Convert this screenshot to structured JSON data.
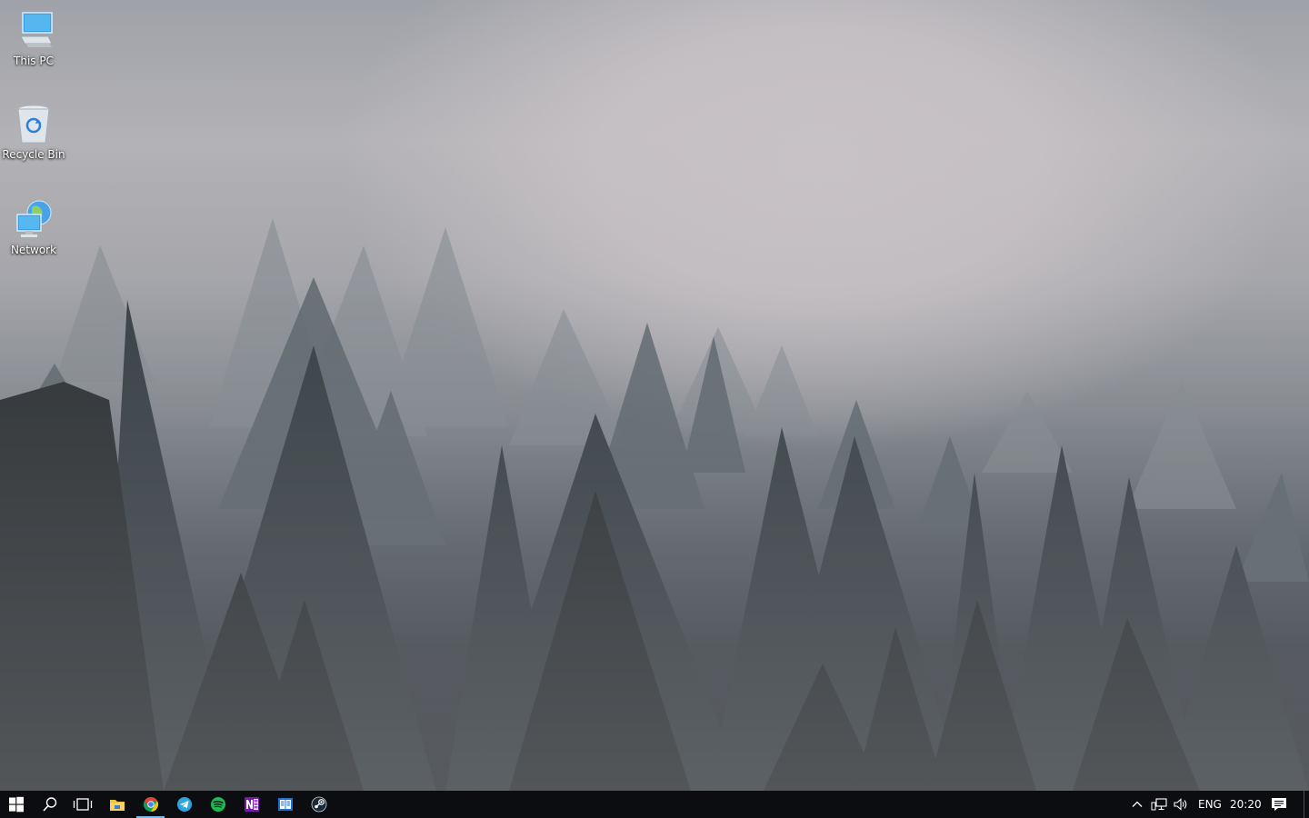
{
  "desktop": {
    "icons": [
      {
        "label": "This PC",
        "icon": "this-pc-icon"
      },
      {
        "label": "Recycle Bin",
        "icon": "recycle-bin-icon"
      },
      {
        "label": "Network",
        "icon": "network-icon"
      }
    ]
  },
  "taskbar": {
    "start": {
      "icon": "windows-start-icon"
    },
    "search": {
      "icon": "search-icon"
    },
    "task_view": {
      "icon": "task-view-icon"
    },
    "apps": [
      {
        "name": "File Explorer",
        "icon": "file-explorer-icon",
        "active": false
      },
      {
        "name": "Google Chrome",
        "icon": "chrome-icon",
        "active": true
      },
      {
        "name": "Telegram",
        "icon": "telegram-icon",
        "active": false
      },
      {
        "name": "Spotify",
        "icon": "spotify-icon",
        "active": false
      },
      {
        "name": "OneNote",
        "icon": "onenote-icon",
        "active": false
      },
      {
        "name": "Reader",
        "icon": "reader-icon",
        "active": false
      },
      {
        "name": "Steam",
        "icon": "steam-icon",
        "active": false
      }
    ],
    "tray": {
      "language": "ENG",
      "time": "20:20",
      "icons": [
        "show-hidden-icons-chevron-icon",
        "network-status-icon",
        "volume-icon",
        "action-center-icon"
      ]
    }
  },
  "colors": {
    "taskbar_bg": "#0c0d10",
    "active_indicator": "#76b9ed",
    "chrome_red": "#db4437",
    "chrome_yellow": "#f4c20d",
    "chrome_green": "#0f9d58",
    "chrome_blue": "#4285f4",
    "telegram_blue": "#2ca5e0",
    "spotify_green": "#1db954",
    "onenote_purple": "#7719aa",
    "steam_navy": "#1b2838"
  }
}
